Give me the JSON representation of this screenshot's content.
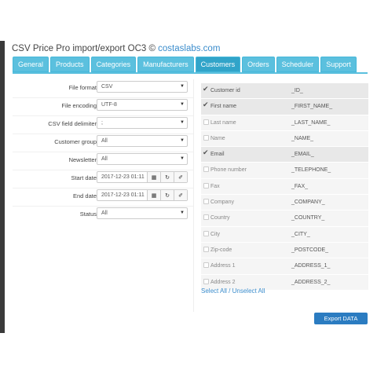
{
  "header": {
    "title_prefix": "CSV Price Pro import/export OC3 ©",
    "title_link": "costaslabs.com"
  },
  "tabs": [
    {
      "label": "General"
    },
    {
      "label": "Products"
    },
    {
      "label": "Categories"
    },
    {
      "label": "Manufacturers"
    },
    {
      "label": "Customers",
      "active": true
    },
    {
      "label": "Orders"
    },
    {
      "label": "Scheduler"
    },
    {
      "label": "Support"
    }
  ],
  "form": {
    "file_format": {
      "label": "File format",
      "value": "CSV"
    },
    "file_encoding": {
      "label": "File encoding",
      "value": "UTF-8"
    },
    "delimiter": {
      "label": "CSV field delimiter",
      "value": ";"
    },
    "customer_group": {
      "label": "Customer group",
      "value": "All"
    },
    "newsletter": {
      "label": "Newsletter",
      "value": "All"
    },
    "start_date": {
      "label": "Start date",
      "value": "2017-12-23 01:11"
    },
    "end_date": {
      "label": "End date",
      "value": "2017-12-23 01:11"
    },
    "status": {
      "label": "Status",
      "value": "All"
    }
  },
  "fields": [
    {
      "name": "Customer id",
      "token": "_ID_",
      "checked": true
    },
    {
      "name": "First name",
      "token": "_FIRST_NAME_",
      "checked": true
    },
    {
      "name": "Last name",
      "token": "_LAST_NAME_",
      "checked": false
    },
    {
      "name": "Name",
      "token": "_NAME_",
      "checked": false
    },
    {
      "name": "Email",
      "token": "_EMAIL_",
      "checked": true
    },
    {
      "name": "Phone number",
      "token": "_TELEPHONE_",
      "checked": false
    },
    {
      "name": "Fax",
      "token": "_FAX_",
      "checked": false
    },
    {
      "name": "Company",
      "token": "_COMPANY_",
      "checked": false
    },
    {
      "name": "Country",
      "token": "_COUNTRY_",
      "checked": false
    },
    {
      "name": "City",
      "token": "_CITY_",
      "checked": false
    },
    {
      "name": "Zip-code",
      "token": "_POSTCODE_",
      "checked": false
    },
    {
      "name": "Address 1",
      "token": "_ADDRESS_1_",
      "checked": false
    },
    {
      "name": "Address 2",
      "token": "_ADDRESS_2_",
      "checked": false
    }
  ],
  "links": {
    "select_all": "Select All",
    "separator": "/",
    "unselect_all": "Unselect All"
  },
  "actions": {
    "export": "Export DATA"
  },
  "colors": {
    "tab": "#5bc0de",
    "tab_active": "#31a4c9",
    "export_button": "#2b7cc1",
    "link": "#3a8ccc"
  }
}
